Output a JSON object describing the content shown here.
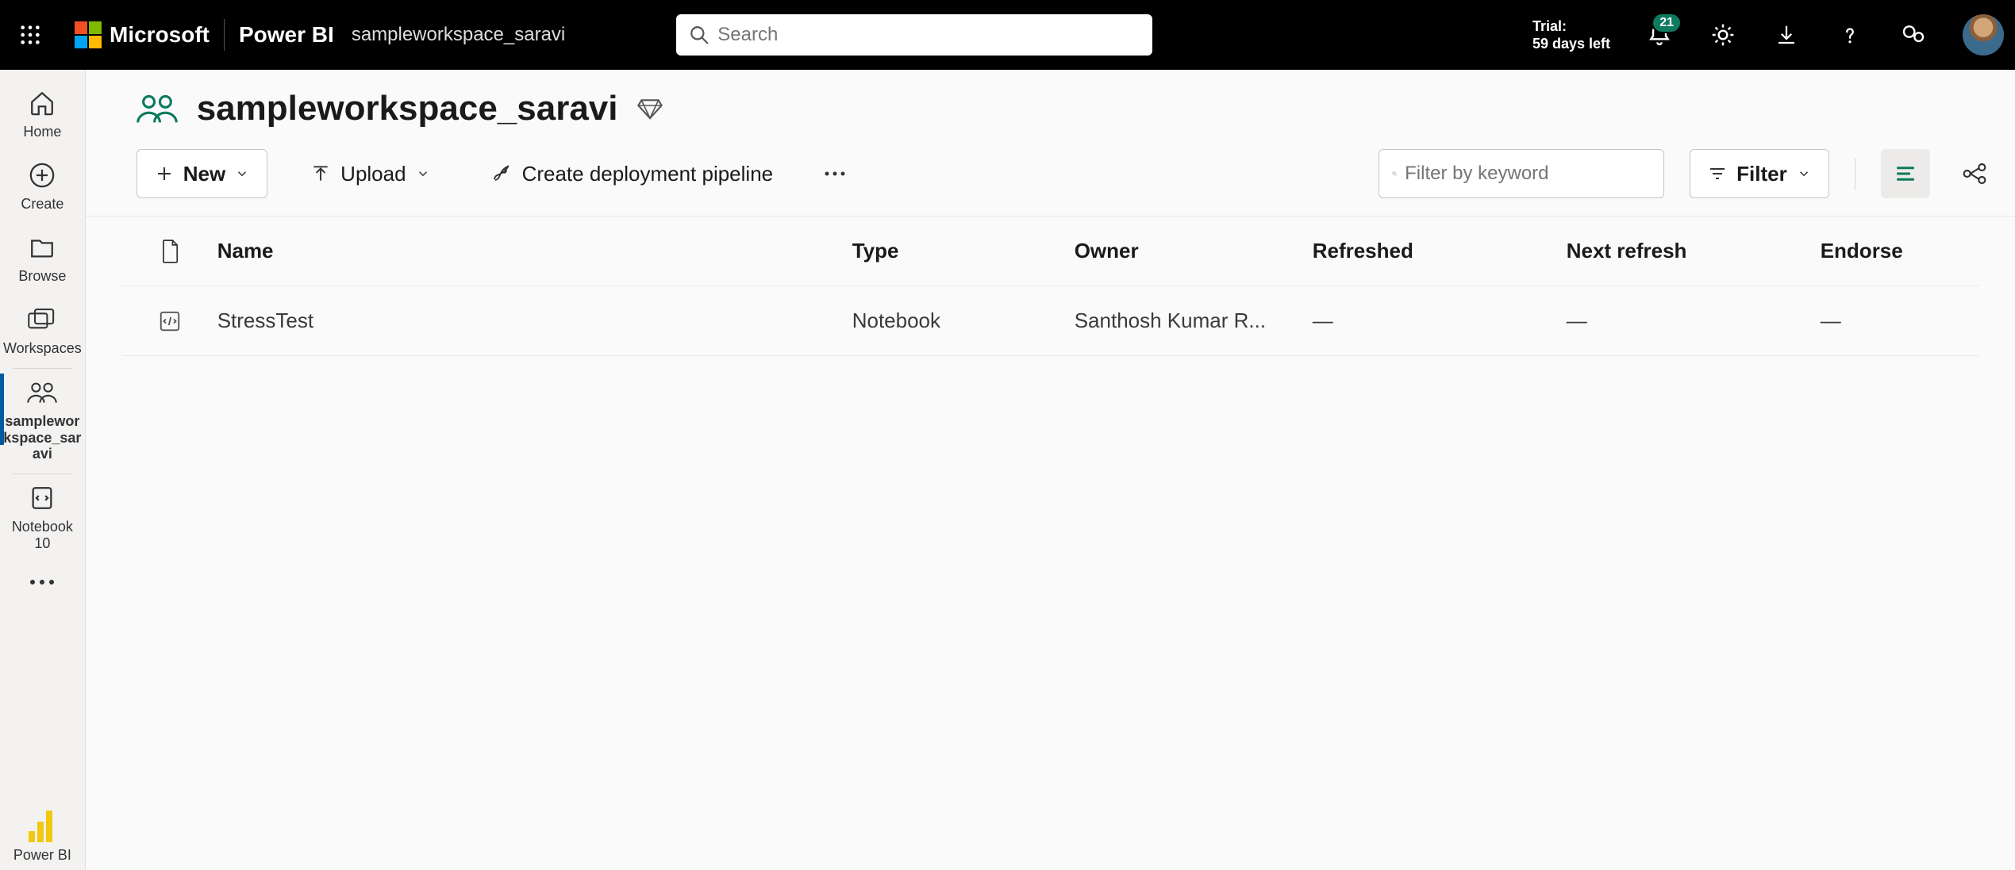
{
  "header": {
    "brand_text": "Microsoft",
    "product": "Power BI",
    "workspace": "sampleworkspace_saravi",
    "search_placeholder": "Search",
    "trial_label": "Trial:",
    "trial_remaining": "59 days left",
    "notification_count": "21"
  },
  "rail": {
    "home": "Home",
    "create": "Create",
    "browse": "Browse",
    "workspaces": "Workspaces",
    "current_ws": "sampleworkspace_saravi",
    "notebook": "Notebook 10",
    "powerbi": "Power BI"
  },
  "main": {
    "workspace_title": "sampleworkspace_saravi",
    "toolbar": {
      "new": "New",
      "upload": "Upload",
      "pipeline": "Create deployment pipeline",
      "filter_placeholder": "Filter by keyword",
      "filter": "Filter"
    },
    "columns": {
      "name": "Name",
      "type": "Type",
      "owner": "Owner",
      "refreshed": "Refreshed",
      "next_refresh": "Next refresh",
      "endorse": "Endorse"
    },
    "rows": [
      {
        "name": "StressTest",
        "type": "Notebook",
        "owner": "Santhosh Kumar R...",
        "refreshed": "—",
        "next_refresh": "—",
        "endorse": "—"
      }
    ]
  }
}
